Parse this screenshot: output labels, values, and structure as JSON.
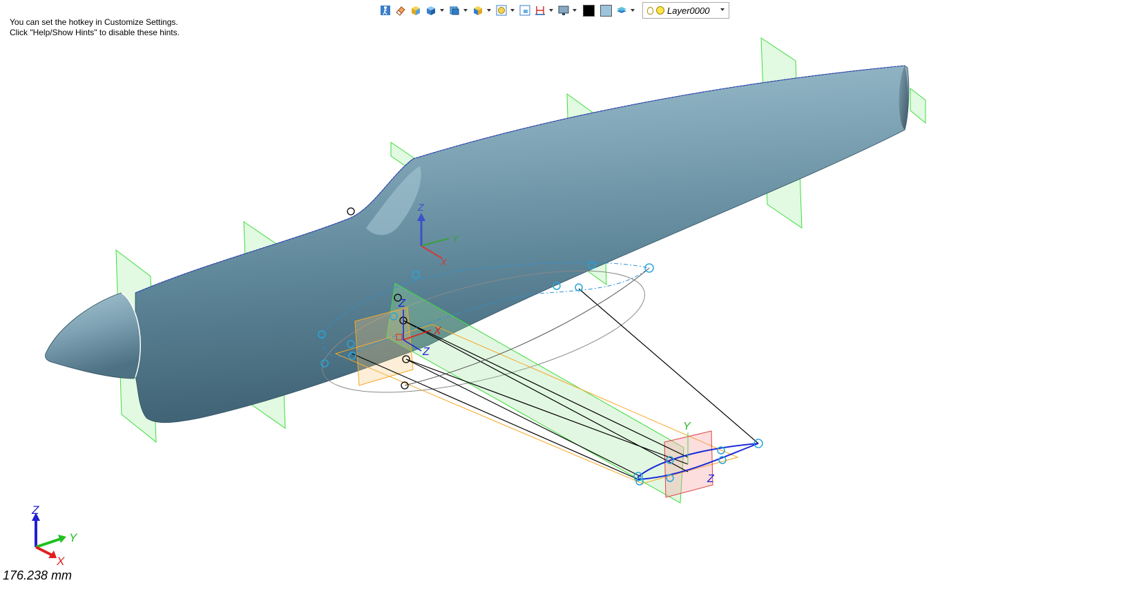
{
  "hints": {
    "line1": "You can set the hotkey in Customize Settings.",
    "line2": "Click \"Help/Show Hints\" to disable these hints."
  },
  "toolbar": {
    "buttons": [
      {
        "icon": "walk-icon",
        "has_dropdown": false
      },
      {
        "icon": "eraser-icon",
        "has_dropdown": false
      },
      {
        "icon": "shaded-cube-icon",
        "has_dropdown": false
      },
      {
        "icon": "render-mode-icon",
        "has_dropdown": true
      },
      {
        "icon": "view-cube-icon",
        "has_dropdown": true
      },
      {
        "icon": "section-view-icon",
        "has_dropdown": true
      },
      {
        "icon": "zoom-icon",
        "has_dropdown": true
      },
      {
        "icon": "fit-view-icon",
        "has_dropdown": false
      },
      {
        "icon": "dimension-icon",
        "has_dropdown": true
      },
      {
        "icon": "monitor-icon",
        "has_dropdown": true
      },
      {
        "icon": "black-color-icon",
        "has_dropdown": false
      },
      {
        "icon": "blue-color-icon",
        "has_dropdown": false
      },
      {
        "icon": "layer-stack-icon",
        "has_dropdown": true
      }
    ],
    "colors": {
      "black": "#000000",
      "blue": "#9ec3dc"
    },
    "layer": {
      "name": "Layer0000"
    }
  },
  "viewport": {
    "body_color": "#5e8799",
    "triad_labels": {
      "x": "X",
      "y": "Y",
      "z": "Z"
    }
  },
  "status": {
    "measurement": "176.238 mm"
  }
}
